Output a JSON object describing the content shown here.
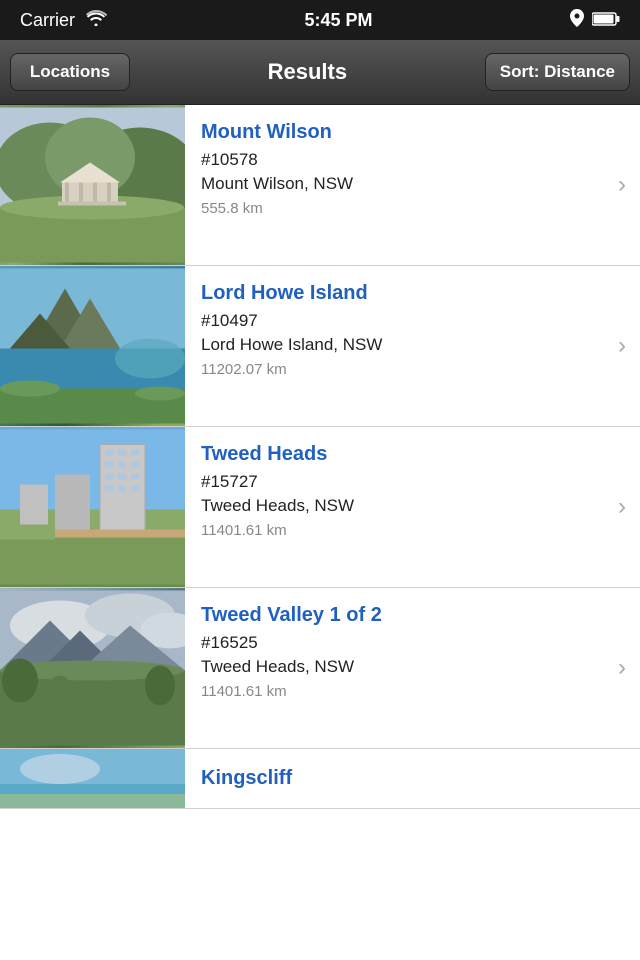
{
  "status_bar": {
    "carrier": "Carrier",
    "time": "5:45 PM"
  },
  "nav": {
    "back_label": "Locations",
    "title": "Results",
    "sort_label": "Sort: Distance"
  },
  "results": [
    {
      "id": "mount-wilson",
      "name": "Mount Wilson",
      "number": "#10578",
      "location": "Mount Wilson, NSW",
      "distance": "555.8 km",
      "thumb_class": "thumb-mount-wilson"
    },
    {
      "id": "lord-howe-island",
      "name": "Lord Howe Island",
      "number": "#10497",
      "location": "Lord Howe Island, NSW",
      "distance": "11202.07 km",
      "thumb_class": "thumb-lord-howe"
    },
    {
      "id": "tweed-heads",
      "name": "Tweed Heads",
      "number": "#15727",
      "location": "Tweed Heads, NSW",
      "distance": "11401.61 km",
      "thumb_class": "thumb-tweed-heads"
    },
    {
      "id": "tweed-valley",
      "name": "Tweed Valley 1 of 2",
      "number": "#16525",
      "location": "Tweed Heads, NSW",
      "distance": "11401.61 km",
      "thumb_class": "thumb-tweed-valley"
    },
    {
      "id": "kingscliff",
      "name": "Kingscliff",
      "number": "",
      "location": "",
      "distance": "",
      "thumb_class": "thumb-kingscliff"
    }
  ],
  "chevron": "›",
  "colors": {
    "accent_blue": "#2060c0",
    "nav_bg": "#444444",
    "distance_gray": "#888888"
  }
}
